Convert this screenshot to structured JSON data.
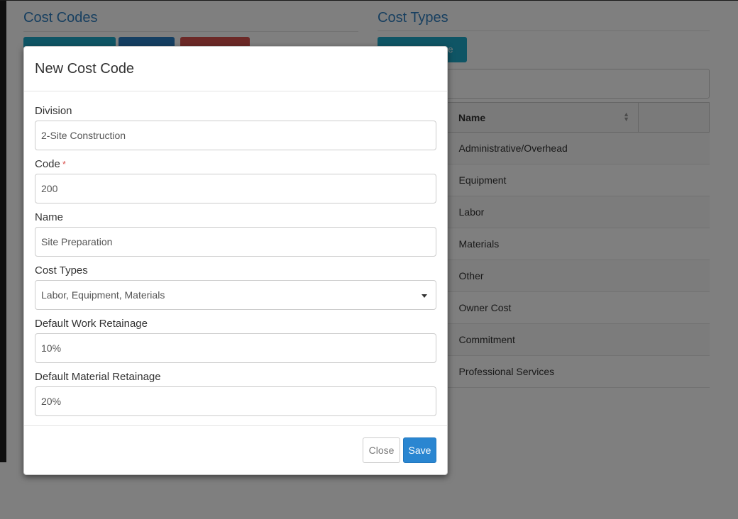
{
  "background": {
    "cost_codes": {
      "title": "Cost Codes"
    },
    "cost_types": {
      "title": "Cost Types",
      "add_button_partial": "pe",
      "table": {
        "header": "Name",
        "rows": [
          "Administrative/Overhead",
          "Equipment",
          "Labor",
          "Materials",
          "Other",
          "Owner Cost",
          "Commitment",
          "Professional Services"
        ]
      }
    }
  },
  "modal": {
    "title": "New Cost Code",
    "fields": {
      "division": {
        "label": "Division",
        "value": "2-Site Construction"
      },
      "code": {
        "label": "Code",
        "required_mark": "*",
        "value": "200"
      },
      "name": {
        "label": "Name",
        "value": "Site Preparation"
      },
      "cost_types": {
        "label": "Cost Types",
        "value": "Labor, Equipment, Materials"
      },
      "work_retainage": {
        "label": "Default Work Retainage",
        "value": "10%"
      },
      "material_retainage": {
        "label": "Default Material Retainage",
        "value": "20%"
      }
    },
    "footer": {
      "close_label": "Close",
      "save_label": "Save"
    }
  },
  "colors": {
    "accent_blue": "#2a86d1",
    "section_title": "#2f7fc0",
    "teal_button": "#1eaacb",
    "danger_button": "#d9534f",
    "required": "#d9534f"
  }
}
